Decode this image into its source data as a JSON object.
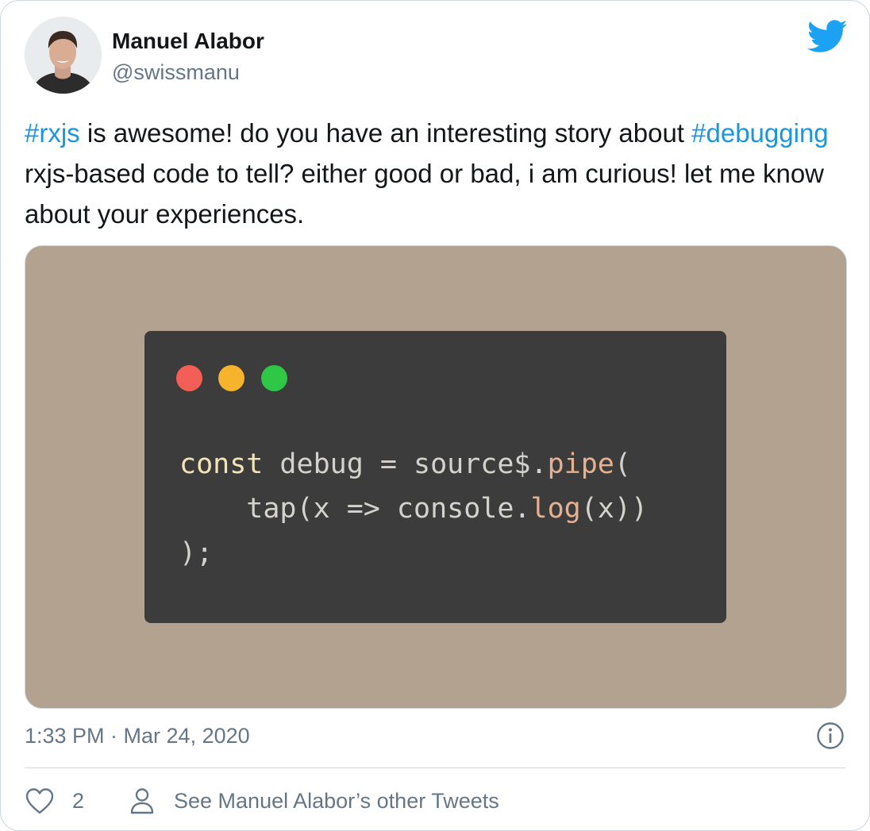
{
  "author": {
    "name": "Manuel Alabor",
    "handle": "@swissmanu"
  },
  "tweet": {
    "segments": [
      {
        "type": "hashtag",
        "text": "#rxjs"
      },
      {
        "type": "text",
        "text": " is awesome! do you have an interesting story about "
      },
      {
        "type": "hashtag",
        "text": "#debugging"
      },
      {
        "type": "text",
        "text": " rxjs-based code to tell? either good or bad, i am curious! let me know about your experiences."
      }
    ]
  },
  "media": {
    "code_lines": [
      [
        {
          "t": "kw",
          "v": "const"
        },
        {
          "t": "pl",
          "v": " debug = source$."
        },
        {
          "t": "fn",
          "v": "pipe"
        },
        {
          "t": "pl",
          "v": "("
        }
      ],
      [
        {
          "t": "pl",
          "v": "    tap(x => console."
        },
        {
          "t": "fn",
          "v": "log"
        },
        {
          "t": "pl",
          "v": "(x))"
        }
      ],
      [
        {
          "t": "pl",
          "v": ");"
        }
      ]
    ],
    "window_dot_colors": [
      "#f35f56",
      "#f6b32b",
      "#2ec846"
    ]
  },
  "meta": {
    "timestamp": "1:33 PM · Mar 24, 2020"
  },
  "actions": {
    "like_count": "2",
    "profile_link": "See Manuel Alabor’s other Tweets"
  },
  "icons": {
    "brand": "twitter-bird-icon",
    "info": "info-icon",
    "like": "heart-icon",
    "profile": "person-icon"
  },
  "colors": {
    "brand": "#1da1f2",
    "hashtag": "#1b95e0",
    "secondary_text": "#657786",
    "media_background": "#b4a291",
    "code_background": "#3c3c3c"
  }
}
